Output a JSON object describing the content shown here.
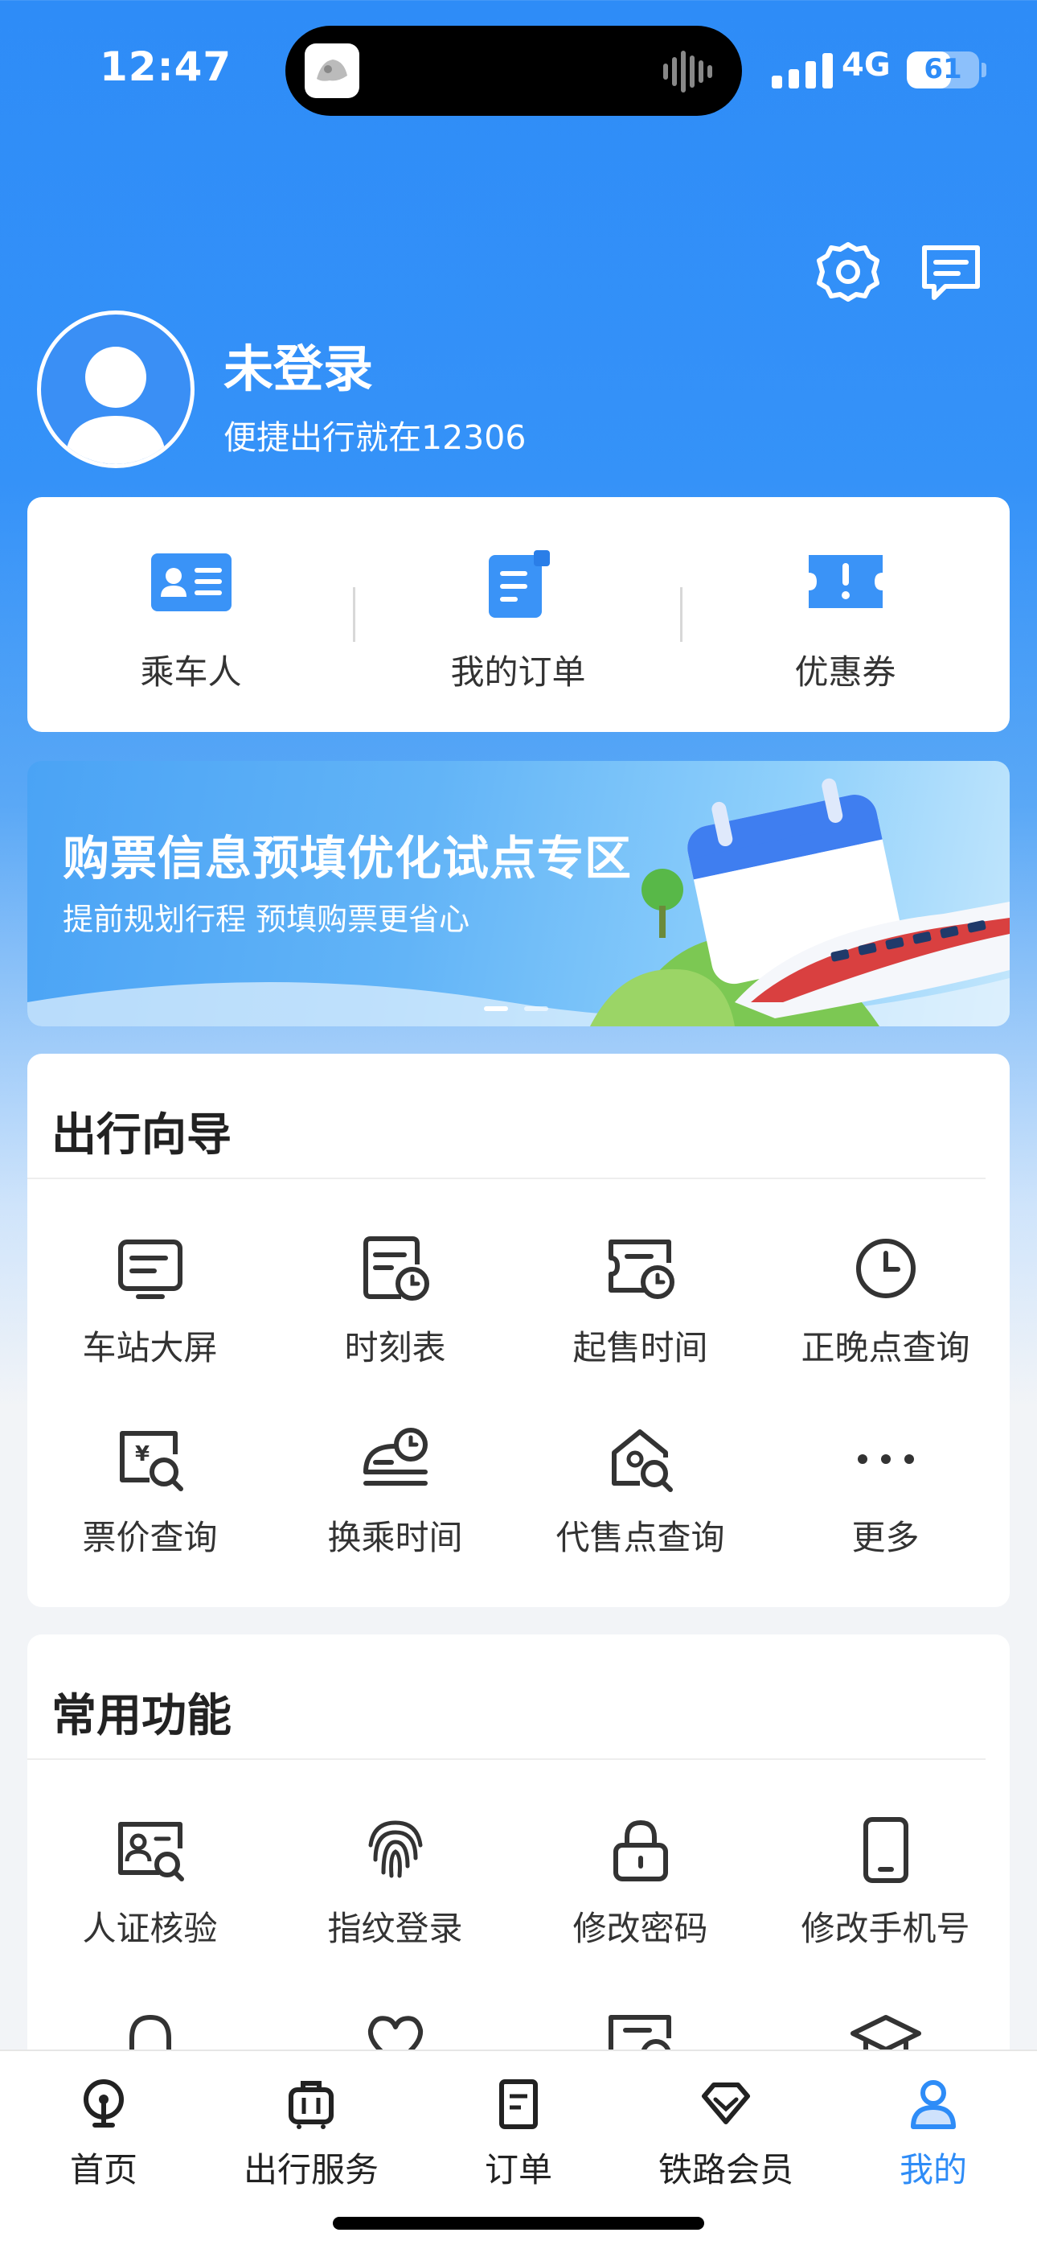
{
  "status_bar": {
    "time": "12:47",
    "network": "4G",
    "battery": "61",
    "battery_level": 0.61
  },
  "header": {
    "settings_icon": "gear-icon",
    "message_icon": "message-icon"
  },
  "profile": {
    "name": "未登录",
    "subtitle": "便捷出行就在12306"
  },
  "quick_actions": [
    {
      "label": "乘车人",
      "icon": "passenger-card-icon"
    },
    {
      "label": "我的订单",
      "icon": "order-list-icon"
    },
    {
      "label": "优惠券",
      "icon": "coupon-icon"
    }
  ],
  "banner": {
    "title": "购票信息预填优化试点专区",
    "subtitle": "提前规划行程 预填购票更省心",
    "page_index": 1,
    "page_count": 2
  },
  "travel_guide": {
    "title": "出行向导",
    "items": [
      {
        "label": "车站大屏",
        "icon": "station-screen-icon"
      },
      {
        "label": "时刻表",
        "icon": "timetable-icon"
      },
      {
        "label": "起售时间",
        "icon": "sale-time-icon"
      },
      {
        "label": "正晚点查询",
        "icon": "clock-icon"
      },
      {
        "label": "票价查询",
        "icon": "fare-search-icon"
      },
      {
        "label": "换乘时间",
        "icon": "transfer-time-icon"
      },
      {
        "label": "代售点查询",
        "icon": "agency-search-icon"
      },
      {
        "label": "更多",
        "icon": "more-icon"
      }
    ]
  },
  "common_functions": {
    "title": "常用功能",
    "items": [
      {
        "label": "人证核验",
        "icon": "id-verify-icon"
      },
      {
        "label": "指纹登录",
        "icon": "fingerprint-icon"
      },
      {
        "label": "修改密码",
        "icon": "lock-icon"
      },
      {
        "label": "修改手机号",
        "icon": "phone-icon"
      }
    ],
    "partial_icons": [
      "bell-icon",
      "heart-icon",
      "ticket-icon",
      "graduation-cap-icon"
    ]
  },
  "tabbar": [
    {
      "label": "首页",
      "icon": "railway-home-icon"
    },
    {
      "label": "出行服务",
      "icon": "luggage-icon"
    },
    {
      "label": "订单",
      "icon": "order-icon"
    },
    {
      "label": "铁路会员",
      "icon": "diamond-icon"
    },
    {
      "label": "我的",
      "icon": "user-icon",
      "active": true
    }
  ],
  "colors": {
    "primary": "#2e8cf7",
    "card": "#ffffff",
    "text": "#222222"
  }
}
